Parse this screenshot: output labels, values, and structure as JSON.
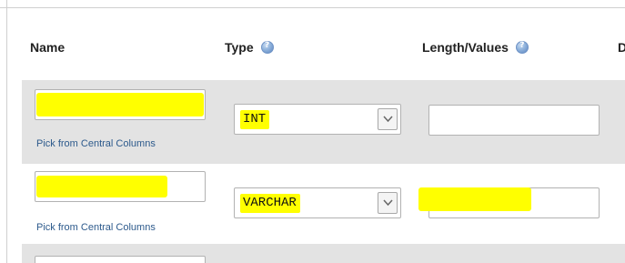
{
  "headers": {
    "name": "Name",
    "type": "Type",
    "length_values": "Length/Values",
    "default_partial": "D"
  },
  "icons": {
    "help": "help-icon",
    "dropdown": "chevron-down-icon"
  },
  "rows": [
    {
      "name_value": "",
      "pick_link": "Pick from Central Columns",
      "type_value": "INT",
      "length_value": ""
    },
    {
      "name_value": "",
      "pick_link": "Pick from Central Columns",
      "type_value": "VARCHAR",
      "length_value": ""
    }
  ],
  "colors": {
    "row_stripe": "#e3e3e3",
    "highlight": "#ffff00",
    "link": "#2d5a8c"
  }
}
